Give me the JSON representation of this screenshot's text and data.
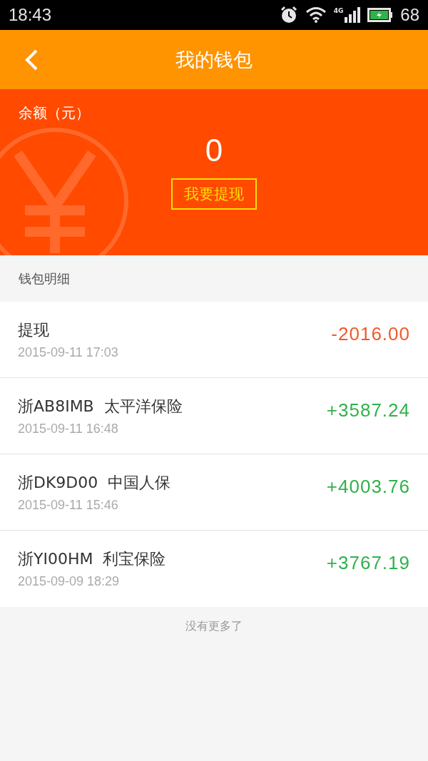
{
  "status_bar": {
    "time": "18:43",
    "network": "4G",
    "battery": "68"
  },
  "header": {
    "title": "我的钱包"
  },
  "balance": {
    "label": "余额（元）",
    "amount": "0",
    "withdraw_button": "我要提现"
  },
  "section_title": "钱包明细",
  "transactions": [
    {
      "kind": "debit",
      "title": "提现",
      "time": "2015-09-11 17:03",
      "amount": "-2016.00"
    },
    {
      "kind": "credit",
      "title": "浙AB8IMB  太平洋保险",
      "time": "2015-09-11 16:48",
      "amount": "+3587.24"
    },
    {
      "kind": "credit",
      "title": "浙DK9D00  中国人保",
      "time": "2015-09-11 15:46",
      "amount": "+4003.76"
    },
    {
      "kind": "credit",
      "title": "浙YI00HM  利宝保险",
      "time": "2015-09-09 18:29",
      "amount": "+3767.19"
    }
  ],
  "footer_note": "没有更多了"
}
